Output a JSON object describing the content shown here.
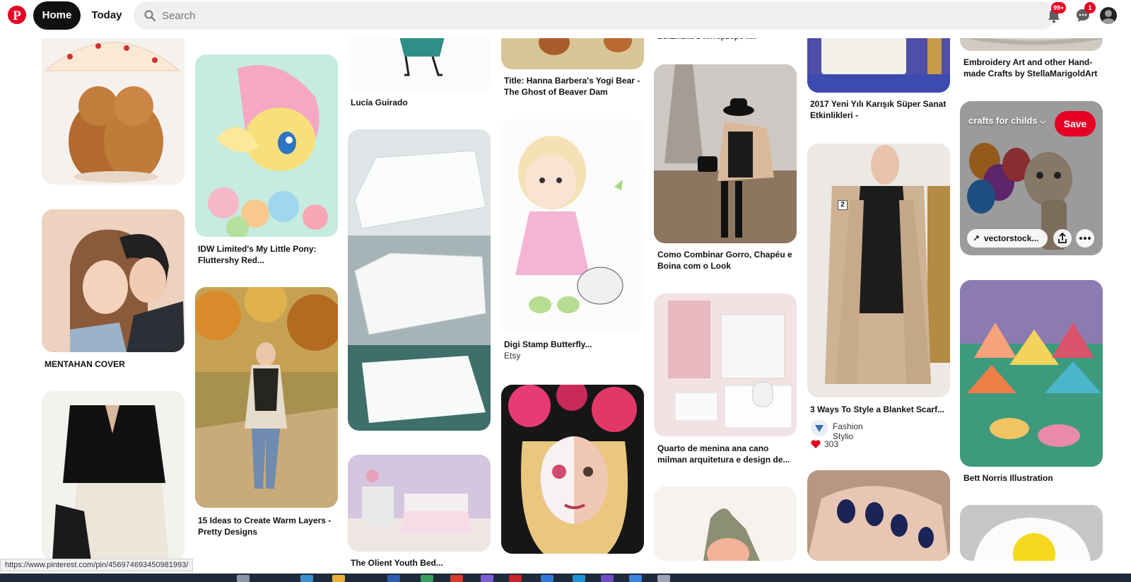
{
  "header": {
    "home_label": "Home",
    "today_label": "Today",
    "search_placeholder": "Search",
    "notifications_badge": "99+",
    "messages_badge": "1",
    "brand_color": "#e60023"
  },
  "pins": {
    "c1_p2_title": "MENTAHAN COVER",
    "c2_p1_title": "IDW Limited's My Little Pony: Fluttershy Red...",
    "c2_p2_title": "15 Ideas to Create Warm Layers - Pretty Designs",
    "c3_p1_title": "Lucía Guirado",
    "c3_p3_title": "The Olient Youth Bed...",
    "c4_p1_title": "Title: Hanna Barbera's Yogi Bear - The Ghost of Beaver Dam",
    "c4_p2_title": "Digi Stamp Butterfly...",
    "c4_p2_sub": "Etsy",
    "c5_p0_title": "Вышивка в интерьере ..... ",
    "c5_p1_title": "Como Combinar Gorro, Chapéu e Boina com o Look",
    "c5_p2_title": "Quarto de menina ana cano milman arquitetura e design de...",
    "c6_p0_title": "2017 Yeni Yılı Karışık Süper Sanat Etkinlikleri -",
    "c6_p1_title": "3 Ways To Style a Blanket Scarf...",
    "c6_p1_creator": "Fashion Stylio",
    "c6_p1_reactions": "303",
    "c6_p1_overlay_num": "2",
    "c7_p0_title": "Embroidery Art and other Hand-made Crafts by StellaMarigoldArt",
    "c7_p1_board": "crafts for childs",
    "c7_p1_save": "Save",
    "c7_p1_link": "vectorstock...",
    "c7_p2_title": "Bett Norris Illustration"
  },
  "status_url": "https://www.pinterest.com/pin/456974693450981993/"
}
